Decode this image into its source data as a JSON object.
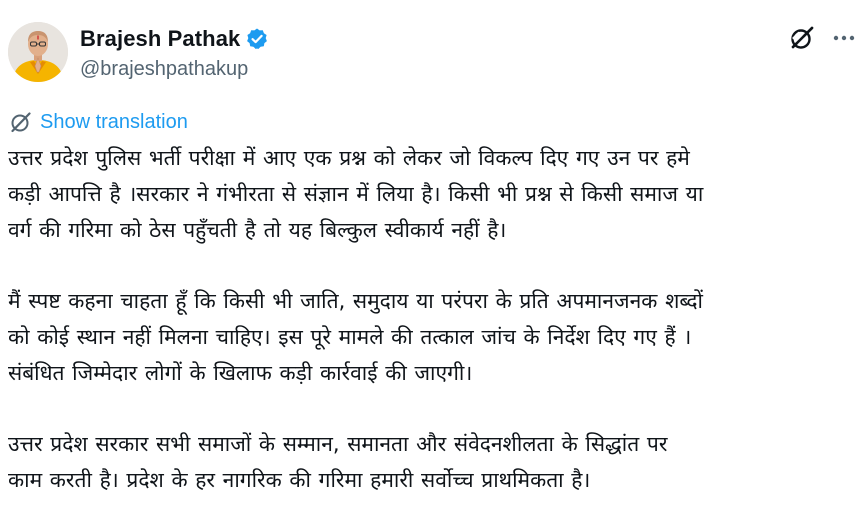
{
  "author": {
    "display_name": "Brajesh Pathak",
    "handle": "@brajeshpathakup",
    "verified": true,
    "avatar_icon": "avatar-image"
  },
  "actions": {
    "grok_icon": "grok-icon",
    "more_icon": "more-horizontal-icon"
  },
  "translation": {
    "icon": "translate-icon",
    "label": "Show translation"
  },
  "tweet": {
    "paragraphs": [
      {
        "lines": [
          "उत्तर प्रदेश पुलिस भर्ती परीक्षा में आए एक प्रश्न को लेकर जो विकल्प दिए गए उन पर हमे",
          "कड़ी आपत्ति है ।सरकार ने गंभीरता से संज्ञान में लिया है। किसी भी प्रश्न से किसी समाज या",
          "वर्ग की गरिमा को ठेस पहुँचती है तो यह बिल्कुल स्वीकार्य नहीं है।"
        ]
      },
      {
        "lines": [
          "मैं स्पष्ट कहना चाहता हूँ कि किसी भी जाति, समुदाय या परंपरा के प्रति अपमानजनक शब्दों",
          "को कोई स्थान नहीं मिलना चाहिए। इस पूरे मामले की तत्काल जांच के निर्देश दिए गए हैं ।",
          "संबंधित जिम्मेदार लोगों के खिलाफ कड़ी कार्रवाई की जाएगी।"
        ]
      },
      {
        "lines": [
          "उत्तर प्रदेश सरकार सभी समाजों के सम्मान, समानता और संवेदनशीलता के सिद्धांत पर",
          "काम करती है। प्रदेश के हर नागरिक की गरिमा हमारी सर्वोच्च प्राथमिकता है।"
        ]
      }
    ]
  },
  "colors": {
    "text": "#0f1419",
    "secondary": "#536471",
    "link": "#1d9bf0",
    "verified": "#1d9bf0",
    "avatar_bg": "#e8e4df",
    "avatar_kurta": "#f5b400"
  }
}
